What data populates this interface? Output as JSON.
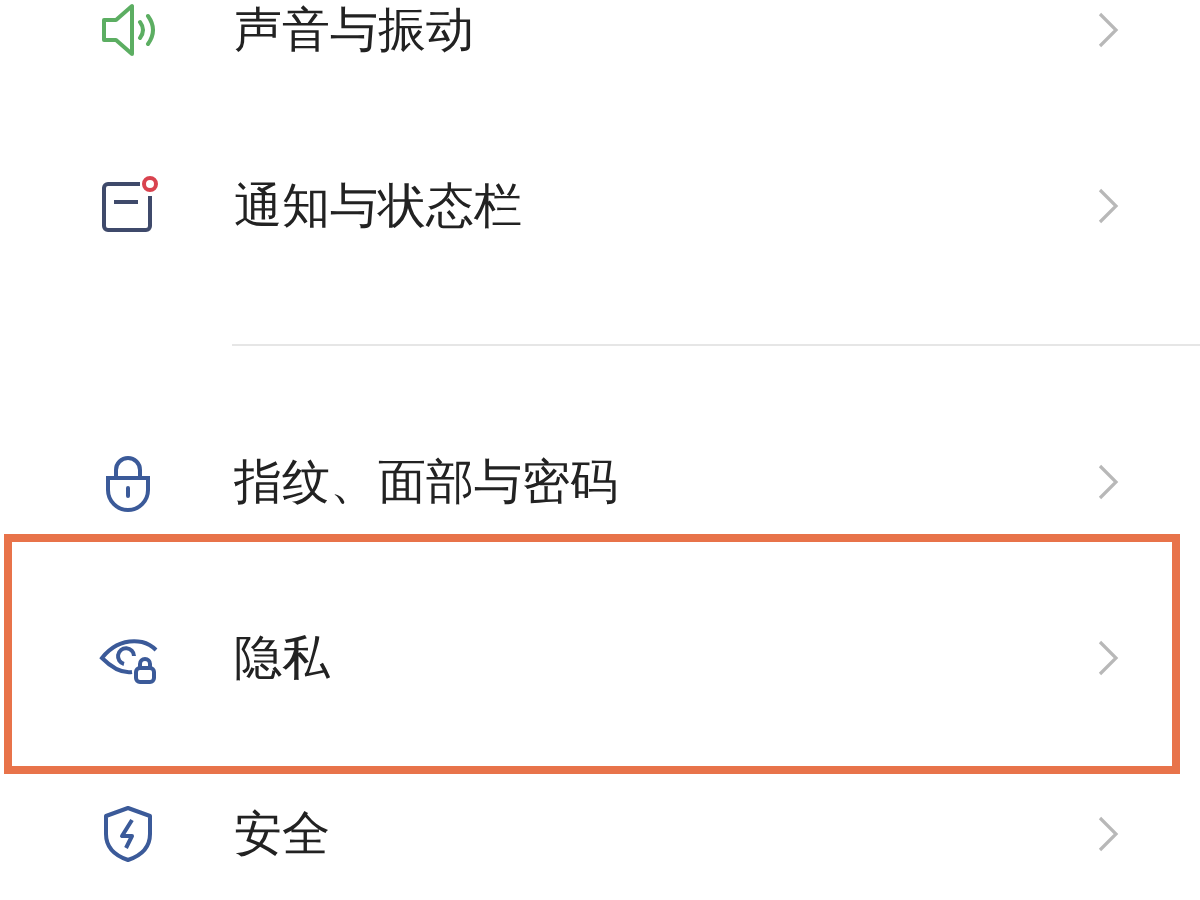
{
  "sections": [
    {
      "items": [
        {
          "kind": "sound",
          "label": "声音与振动",
          "highlighted": false
        },
        {
          "kind": "notification",
          "label": "通知与状态栏",
          "highlighted": false
        }
      ]
    },
    {
      "items": [
        {
          "kind": "lock",
          "label": "指纹、面部与密码",
          "highlighted": false
        },
        {
          "kind": "privacy",
          "label": "隐私",
          "highlighted": true
        },
        {
          "kind": "shield",
          "label": "安全",
          "highlighted": false
        }
      ]
    }
  ]
}
